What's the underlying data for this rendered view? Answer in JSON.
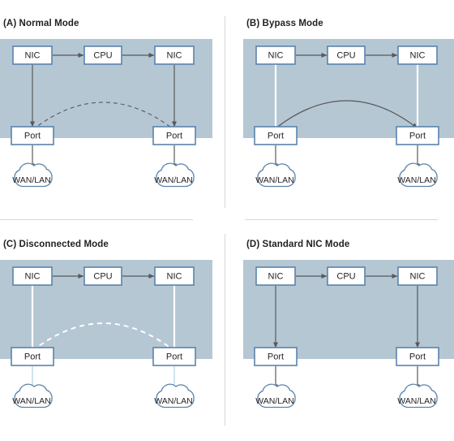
{
  "figure": {
    "title_prefix_style": "letter-paren",
    "colors": {
      "shaded_region": "#b5c7d3",
      "box_border": "#5b83ac",
      "box_fill": "#ffffff",
      "arrow_active": "#58595b",
      "arrow_inactive": "#ffffff",
      "cloud_border": "#5b83ac",
      "link_faint": "#a8cde0",
      "divider": "#d2d8dd",
      "text": "#231f20"
    }
  },
  "panels": [
    {
      "id": "a",
      "title": "(A) Normal Mode",
      "nodes": {
        "nic_left": "NIC",
        "cpu": "CPU",
        "nic_right": "NIC",
        "port_left": "Port",
        "port_right": "Port",
        "cloud_left": "WAN/LAN",
        "cloud_right": "WAN/LAN"
      },
      "links": {
        "nic_cpu_left": "active-bidirectional",
        "nic_cpu_right": "active-bidirectional",
        "nic_port_left": "active-bidirectional",
        "nic_port_right": "active-bidirectional",
        "bypass_arc": "dashed-inactive",
        "port_cloud_left": "active-bidirectional",
        "port_cloud_right": "active-bidirectional"
      }
    },
    {
      "id": "b",
      "title": "(B) Bypass Mode",
      "nodes": {
        "nic_left": "NIC",
        "cpu": "CPU",
        "nic_right": "NIC",
        "port_left": "Port",
        "port_right": "Port",
        "cloud_left": "WAN/LAN",
        "cloud_right": "WAN/LAN"
      },
      "links": {
        "nic_cpu_left": "active-bidirectional",
        "nic_cpu_right": "active-bidirectional",
        "nic_port_left": "inactive-white",
        "nic_port_right": "inactive-white",
        "bypass_arc": "solid-active-bidirectional",
        "port_cloud_left": "active-bidirectional",
        "port_cloud_right": "active-bidirectional"
      }
    },
    {
      "id": "c",
      "title": "(C) Disconnected Mode",
      "nodes": {
        "nic_left": "NIC",
        "cpu": "CPU",
        "nic_right": "NIC",
        "port_left": "Port",
        "port_right": "Port",
        "cloud_left": "WAN/LAN",
        "cloud_right": "WAN/LAN"
      },
      "links": {
        "nic_cpu_left": "active-bidirectional",
        "nic_cpu_right": "active-bidirectional",
        "nic_port_left": "inactive-white",
        "nic_port_right": "inactive-white",
        "bypass_arc": "dashed-white-inactive",
        "port_cloud_left": "faint-no-arrow",
        "port_cloud_right": "faint-no-arrow"
      }
    },
    {
      "id": "d",
      "title": "(D) Standard NIC Mode",
      "nodes": {
        "nic_left": "NIC",
        "cpu": "CPU",
        "nic_right": "NIC",
        "port_left": "Port",
        "port_right": "Port",
        "cloud_left": "WAN/LAN",
        "cloud_right": "WAN/LAN"
      },
      "links": {
        "nic_cpu_left": "active-bidirectional",
        "nic_cpu_right": "active-bidirectional",
        "nic_port_left": "active-bidirectional",
        "nic_port_right": "active-bidirectional",
        "bypass_arc": "none",
        "port_cloud_left": "active-bidirectional",
        "port_cloud_right": "active-bidirectional"
      }
    }
  ]
}
